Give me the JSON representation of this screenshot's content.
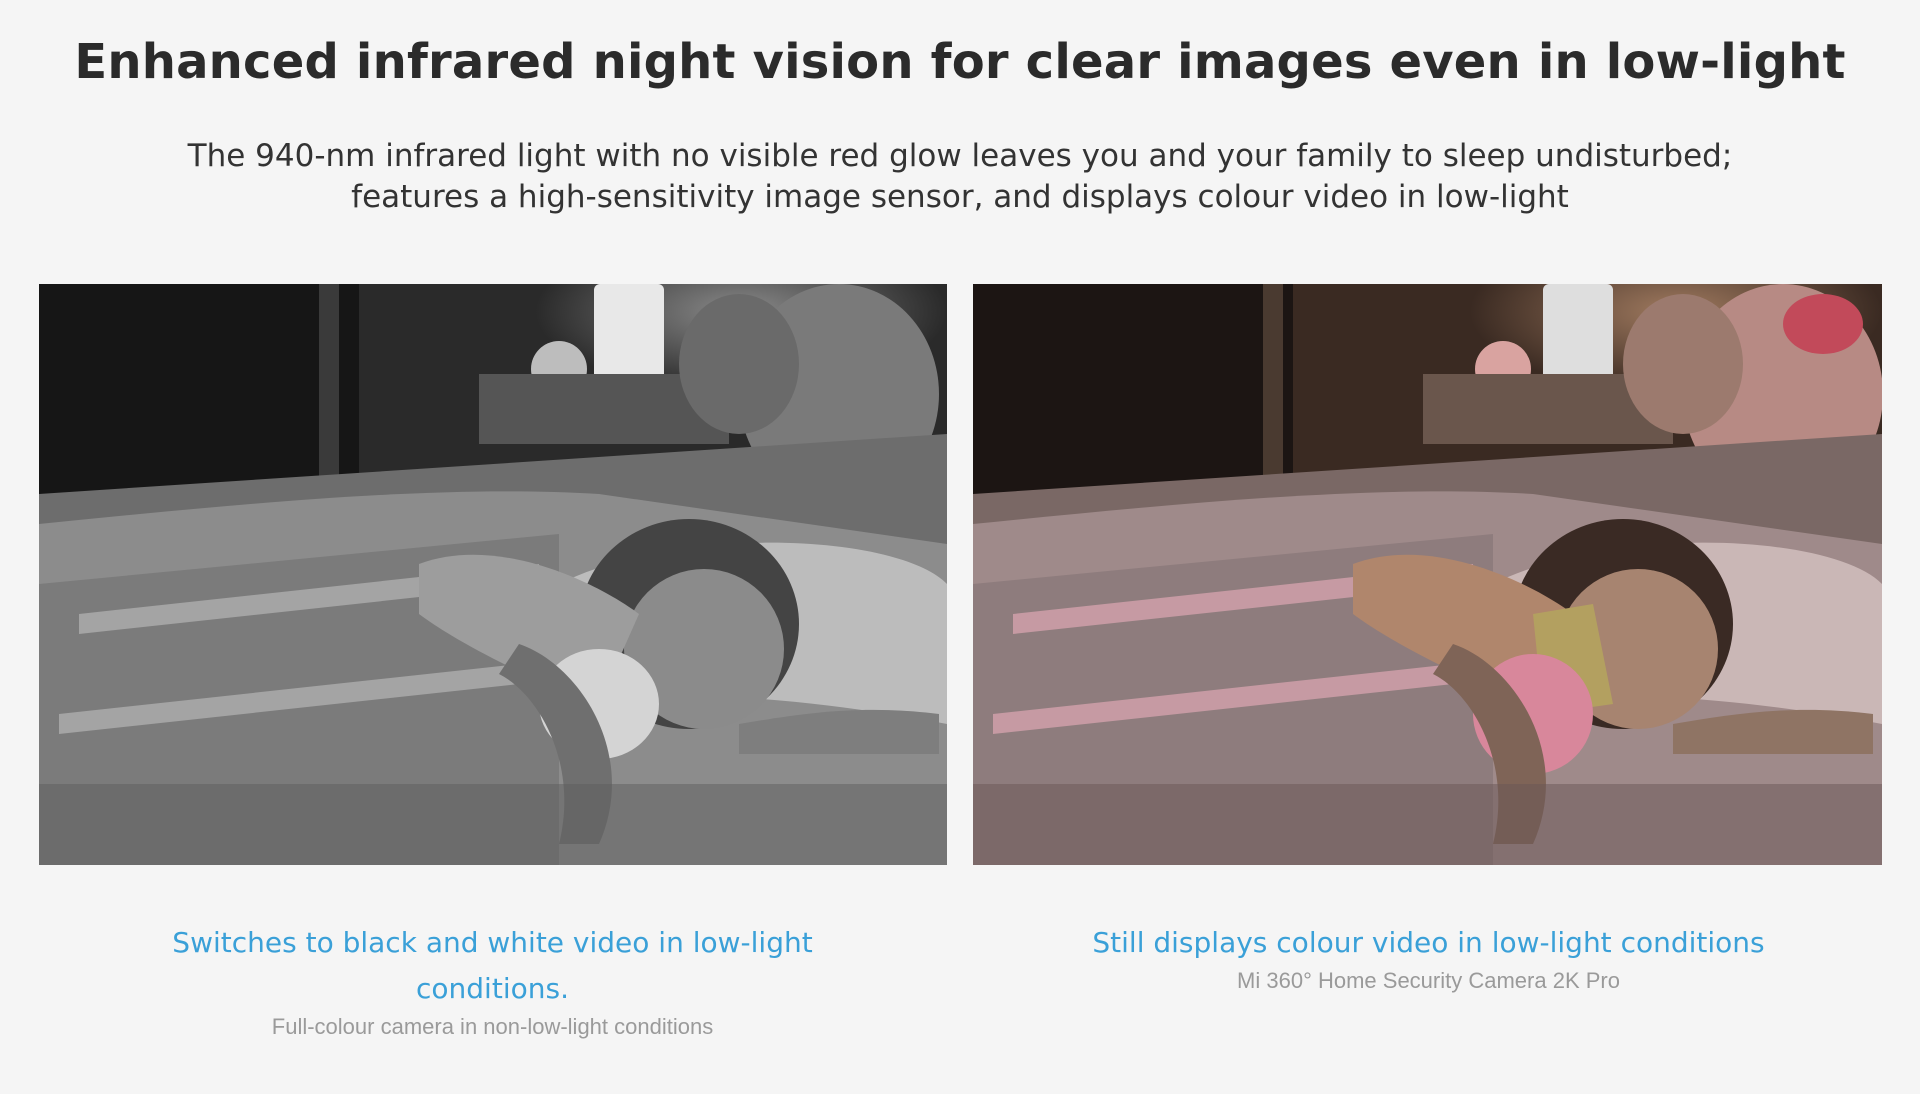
{
  "section": {
    "headline": "Enhanced infrared night vision for clear images even in low-light",
    "subtitle_line1": "The 940-nm infrared light with no visible red glow leaves you and your family to sleep undisturbed;",
    "subtitle_line2": "features a high-sensitivity image sensor, and displays colour video in low-light"
  },
  "comparison": {
    "left": {
      "title": "Switches to black and white video in low-light conditions.",
      "note": "Full-colour camera in non-low-light conditions",
      "image_style": "grayscale"
    },
    "right": {
      "title": "Still displays colour video in low-light conditions",
      "note": "Mi 360° Home Security Camera 2K Pro",
      "image_style": "colour"
    }
  },
  "colors": {
    "accent": "#3aa0d8",
    "background": "#f5f5f5",
    "heading": "#2b2b2b",
    "muted": "#9a9a9a"
  }
}
